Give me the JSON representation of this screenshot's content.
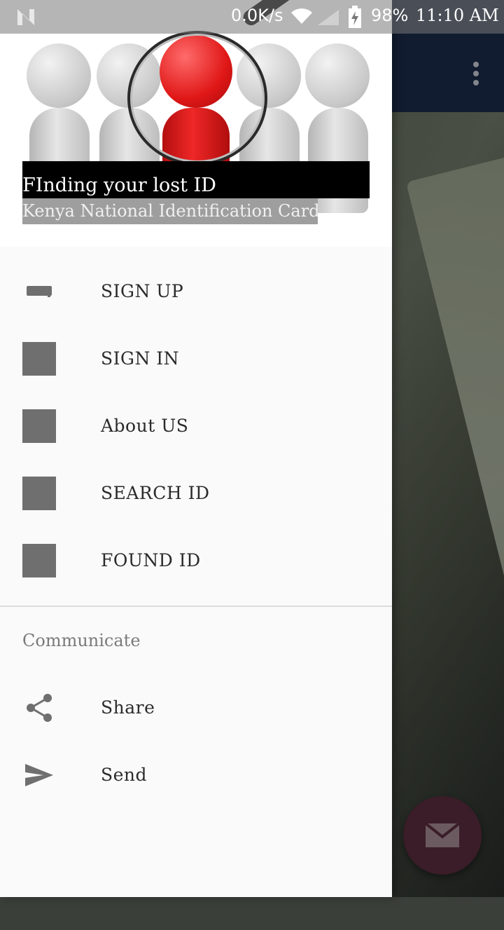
{
  "status_bar": {
    "net_speed": "0.0K/s",
    "battery_percent": "98%",
    "time": "11:10 AM",
    "icons": [
      "n-notification-icon",
      "wifi-icon",
      "signal-icon",
      "battery-charging-icon"
    ]
  },
  "drawer": {
    "header": {
      "title": "FInding your lost ID",
      "subtitle": "Kenya National Identification Card"
    },
    "menu": [
      {
        "label": "SIGN UP",
        "icon": "keyboard-icon"
      },
      {
        "label": "SIGN IN",
        "icon": "placeholder-square-icon"
      },
      {
        "label": "About US",
        "icon": "placeholder-square-icon"
      },
      {
        "label": "SEARCH ID",
        "icon": "placeholder-square-icon"
      },
      {
        "label": "FOUND ID",
        "icon": "placeholder-square-icon"
      }
    ],
    "communicate": {
      "header": "Communicate",
      "items": [
        {
          "label": "Share",
          "icon": "share-icon"
        },
        {
          "label": "Send",
          "icon": "send-icon"
        }
      ]
    }
  },
  "colors": {
    "app_bar": "#1b2b4a",
    "drawer_bg": "#fafafa",
    "fab": "#3a1d28",
    "icon_gray": "#6f6f6f"
  }
}
